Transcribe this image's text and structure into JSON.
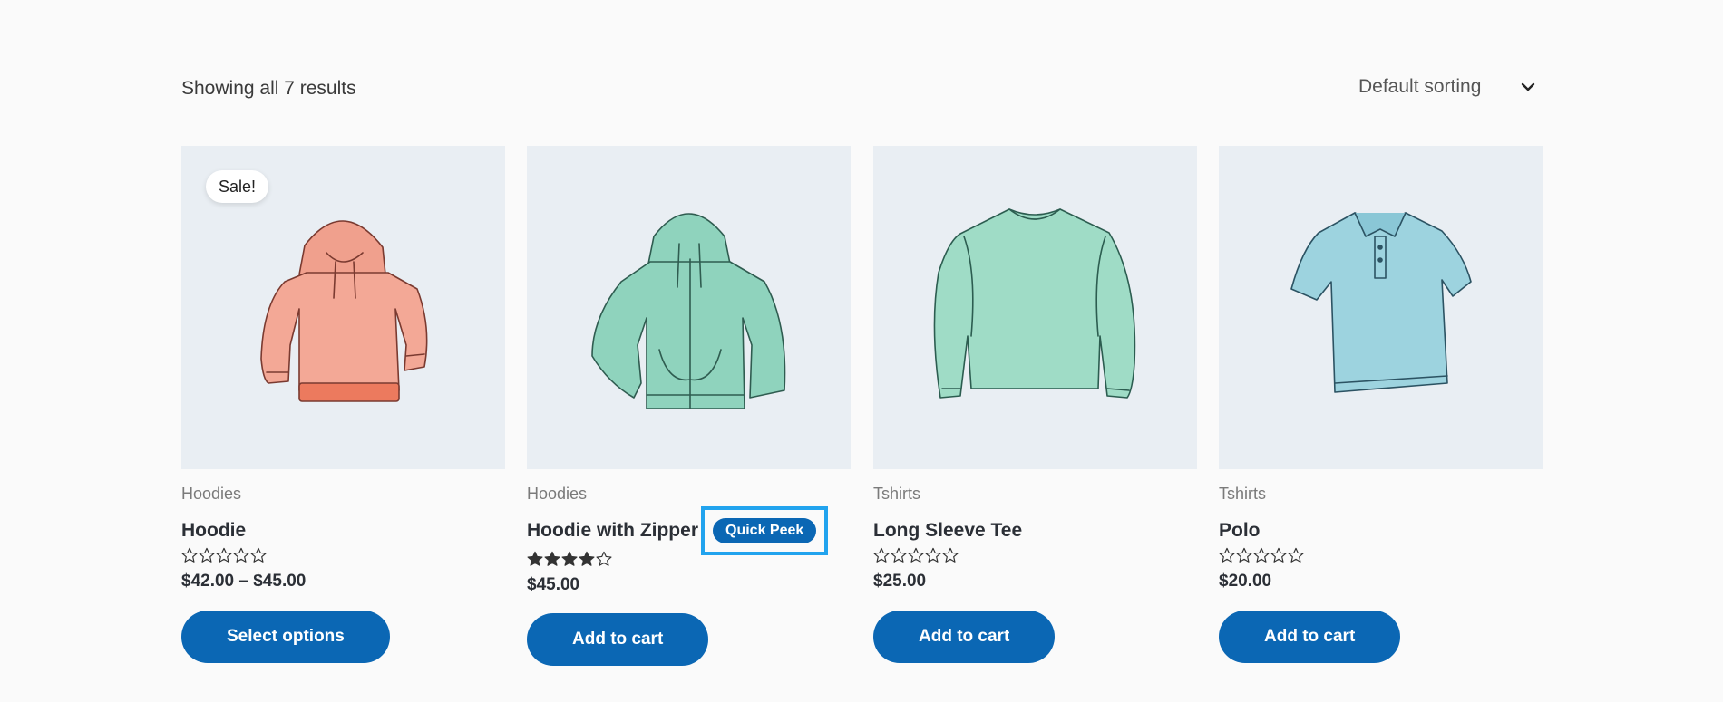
{
  "shop": {
    "result_count": "Showing all 7 results",
    "sorting": {
      "selected": "Default sorting"
    }
  },
  "products": [
    {
      "category": "Hoodies",
      "title": "Hoodie",
      "price": "$42.00 – $45.00",
      "rating": 0,
      "badge": "Sale!",
      "cta": "Select options",
      "image_icon": "hoodie-illustration",
      "color": "#f3a896"
    },
    {
      "category": "Hoodies",
      "title": "Hoodie with Zipper",
      "price": "$45.00",
      "rating": 4,
      "tag": "Quick Peek",
      "cta": "Add to cart",
      "image_icon": "zip-hoodie-illustration",
      "color": "#8fd3bd"
    },
    {
      "category": "Tshirts",
      "title": "Long Sleeve Tee",
      "price": "$25.00",
      "rating": 0,
      "cta": "Add to cart",
      "image_icon": "long-sleeve-tee-illustration",
      "color": "#9fdcc6"
    },
    {
      "category": "Tshirts",
      "title": "Polo",
      "price": "$20.00",
      "rating": 0,
      "cta": "Add to cart",
      "image_icon": "polo-shirt-illustration",
      "color": "#9dd3df"
    }
  ],
  "colors": {
    "accent": "#0b67b4",
    "highlight_frame": "#21a3ee",
    "thumb_background": "#e9eef3"
  }
}
